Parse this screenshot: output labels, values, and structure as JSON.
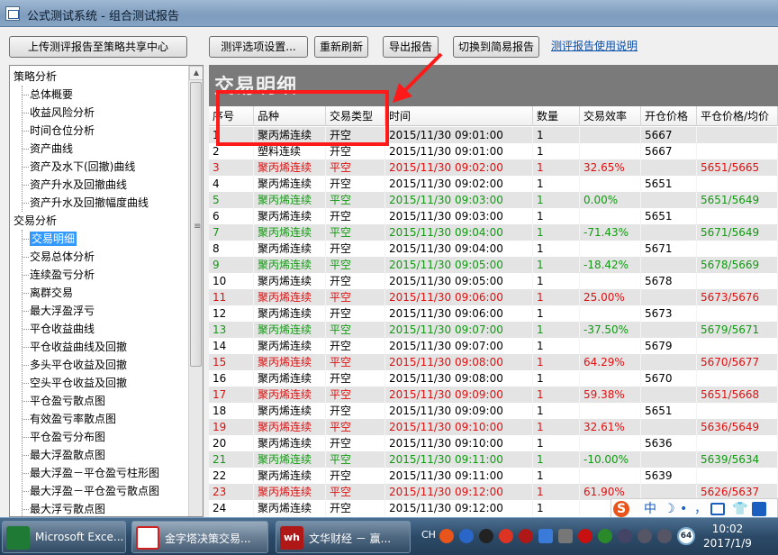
{
  "window": {
    "title": "公式测试系统 - 组合测试报告"
  },
  "toolbar": {
    "upload": "上传测评报告至策略共享中心",
    "options": "测评选项设置...",
    "refresh": "重新刷新",
    "export": "导出报告",
    "switch": "切换到简易报告",
    "help_link": "测评报告使用说明"
  },
  "sidebar": {
    "cat1": "策略分析",
    "cat1_items": [
      "总体概要",
      "收益风险分析",
      "时间仓位分析",
      "资产曲线",
      "资产及水下(回撤)曲线",
      "资产升水及回撤曲线",
      "资产升水及回撤幅度曲线"
    ],
    "cat2": "交易分析",
    "cat2_items": [
      "交易明细",
      "交易总体分析",
      "连续盈亏分析",
      "离群交易",
      "最大浮盈浮亏",
      "平仓收益曲线",
      "平仓收益曲线及回撤",
      "多头平仓收益及回撤",
      "空头平仓收益及回撤",
      "平仓盈亏散点图",
      "有效盈亏率散点图",
      "平仓盈亏分布图",
      "最大浮盈散点图",
      "最大浮盈－平仓盈亏柱形图",
      "最大浮盈－平仓盈亏散点图",
      "最大浮亏散点图"
    ],
    "selected": "交易明细",
    "scroll_grip": "≡"
  },
  "content": {
    "title": "交易明细"
  },
  "grid": {
    "columns": [
      "序号",
      "品种",
      "交易类型",
      "时间",
      "数量",
      "交易效率",
      "开仓价格",
      "平仓价格/均价"
    ],
    "rows": [
      [
        "1",
        "聚丙烯连续",
        "开空",
        "2015/11/30 09:01:00",
        "1",
        "",
        "5667",
        ""
      ],
      [
        "2",
        "塑料连续",
        "开空",
        "2015/11/30 09:01:00",
        "1",
        "",
        "5667",
        ""
      ],
      [
        "3",
        "聚丙烯连续",
        "平空",
        "2015/11/30 09:02:00",
        "1",
        "32.65%",
        "",
        "5651/5665"
      ],
      [
        "4",
        "聚丙烯连续",
        "开空",
        "2015/11/30 09:02:00",
        "1",
        "",
        "5651",
        ""
      ],
      [
        "5",
        "聚丙烯连续",
        "平空",
        "2015/11/30 09:03:00",
        "1",
        "0.00%",
        "",
        "5651/5649"
      ],
      [
        "6",
        "聚丙烯连续",
        "开空",
        "2015/11/30 09:03:00",
        "1",
        "",
        "5651",
        ""
      ],
      [
        "7",
        "聚丙烯连续",
        "平空",
        "2015/11/30 09:04:00",
        "1",
        "-71.43%",
        "",
        "5671/5649"
      ],
      [
        "8",
        "聚丙烯连续",
        "开空",
        "2015/11/30 09:04:00",
        "1",
        "",
        "5671",
        ""
      ],
      [
        "9",
        "聚丙烯连续",
        "平空",
        "2015/11/30 09:05:00",
        "1",
        "-18.42%",
        "",
        "5678/5669"
      ],
      [
        "10",
        "聚丙烯连续",
        "开空",
        "2015/11/30 09:05:00",
        "1",
        "",
        "5678",
        ""
      ],
      [
        "11",
        "聚丙烯连续",
        "平空",
        "2015/11/30 09:06:00",
        "1",
        "25.00%",
        "",
        "5673/5676"
      ],
      [
        "12",
        "聚丙烯连续",
        "开空",
        "2015/11/30 09:06:00",
        "1",
        "",
        "5673",
        ""
      ],
      [
        "13",
        "聚丙烯连续",
        "平空",
        "2015/11/30 09:07:00",
        "1",
        "-37.50%",
        "",
        "5679/5671"
      ],
      [
        "14",
        "聚丙烯连续",
        "开空",
        "2015/11/30 09:07:00",
        "1",
        "",
        "5679",
        ""
      ],
      [
        "15",
        "聚丙烯连续",
        "平空",
        "2015/11/30 09:08:00",
        "1",
        "64.29%",
        "",
        "5670/5677"
      ],
      [
        "16",
        "聚丙烯连续",
        "开空",
        "2015/11/30 09:08:00",
        "1",
        "",
        "5670",
        ""
      ],
      [
        "17",
        "聚丙烯连续",
        "平空",
        "2015/11/30 09:09:00",
        "1",
        "59.38%",
        "",
        "5651/5668"
      ],
      [
        "18",
        "聚丙烯连续",
        "开空",
        "2015/11/30 09:09:00",
        "1",
        "",
        "5651",
        ""
      ],
      [
        "19",
        "聚丙烯连续",
        "平空",
        "2015/11/30 09:10:00",
        "1",
        "32.61%",
        "",
        "5636/5649"
      ],
      [
        "20",
        "聚丙烯连续",
        "开空",
        "2015/11/30 09:10:00",
        "1",
        "",
        "5636",
        ""
      ],
      [
        "21",
        "聚丙烯连续",
        "平空",
        "2015/11/30 09:11:00",
        "1",
        "-10.00%",
        "",
        "5639/5634"
      ],
      [
        "22",
        "聚丙烯连续",
        "开空",
        "2015/11/30 09:11:00",
        "1",
        "",
        "5639",
        ""
      ],
      [
        "23",
        "聚丙烯连续",
        "平空",
        "2015/11/30 09:12:00",
        "1",
        "61.90%",
        "",
        "5626/5637"
      ],
      [
        "24",
        "聚丙烯连续",
        "开空",
        "2015/11/30 09:12:00",
        "1",
        "",
        "",
        ""
      ]
    ],
    "row_colors": [
      "black",
      "black",
      "red",
      "black",
      "green",
      "black",
      "green",
      "black",
      "green",
      "black",
      "red",
      "black",
      "green",
      "black",
      "red",
      "black",
      "red",
      "black",
      "red",
      "black",
      "green",
      "black",
      "red",
      "black"
    ]
  },
  "tray_float": {
    "ime": "中",
    "moon": "☽",
    "dot": "•",
    "comma": "，",
    "shirt": "👕"
  },
  "taskbar": {
    "tasks": [
      "Microsoft Exce...",
      "金字塔决策交易...",
      "文华财经 － 赢..."
    ],
    "wh_logo": "wh",
    "tray_text": "CH",
    "tray_badge": "64",
    "time": "10:02",
    "date": "2017/1/9"
  },
  "colors": {
    "red": "#e01010",
    "green": "#119a11",
    "highlight": "#ff1a1a"
  }
}
